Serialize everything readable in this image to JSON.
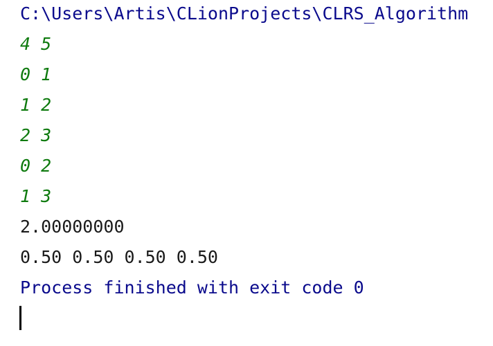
{
  "console": {
    "command_path": "C:\\Users\\Artis\\CLionProjects\\CLRS_Algorithm",
    "input_lines": [
      "4 5",
      "0 1",
      "1 2",
      "2 3",
      "0 2",
      "1 3"
    ],
    "output_lines": [
      "2.00000000",
      "0.50 0.50 0.50 0.50"
    ],
    "exit_message": "Process finished with exit code 0"
  }
}
